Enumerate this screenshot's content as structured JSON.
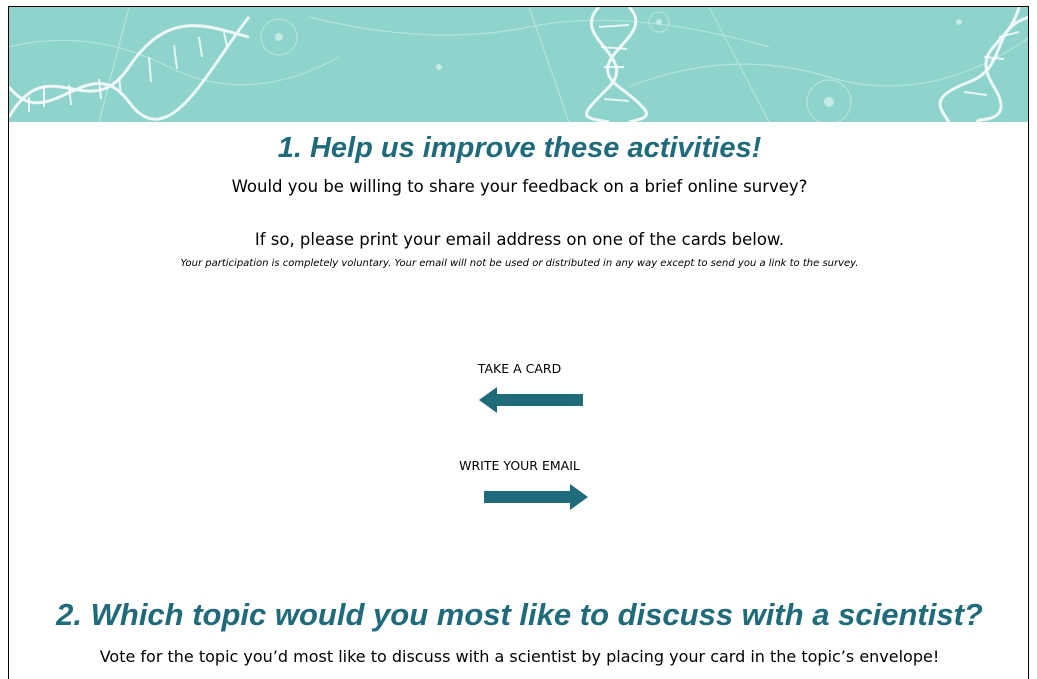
{
  "colors": {
    "banner_bg": "#8ed3cc",
    "heading": "#1f6b7c",
    "arrow": "#1f6b7c"
  },
  "section1": {
    "heading": "1. Help us improve these activities!",
    "question": "Would you be willing to share your feedback on a brief online survey?",
    "instruction": "If so, please print your email address on one of the cards below.",
    "disclaimer": "Your participation is completely voluntary. Your email will not be used or distributed in any way except to send you a link to the survey."
  },
  "arrows": {
    "take_card_label": "TAKE A CARD",
    "take_card_icon": "arrow-left-icon",
    "write_email_label": "WRITE YOUR EMAIL",
    "write_email_icon": "arrow-right-icon"
  },
  "section2": {
    "heading": "2. Which topic would you most like to discuss with a scientist?",
    "instruction": "Vote for the topic you’d most like to discuss with a scientist by placing your card in the topic’s envelope!"
  }
}
